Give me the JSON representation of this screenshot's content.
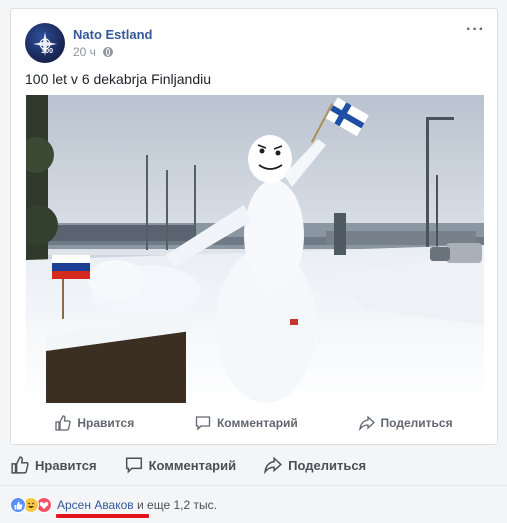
{
  "post": {
    "page_name": "Nato Estland",
    "time": "20 ч",
    "privacy_icon": "globe-icon",
    "more_icon": "more-horizontal-icon",
    "text": "100 let v 6 dekabrja Finljandiu",
    "avatar_tag": "100",
    "photo_icon": "snowman-photo"
  },
  "inner_actions": {
    "like": "Нравится",
    "comment": "Комментарий",
    "share": "Поделиться"
  },
  "outer_actions": {
    "like": "Нравится",
    "comment": "Комментарий",
    "share": "Поделиться"
  },
  "reactions": {
    "icons": [
      "like-reaction-icon",
      "haha-reaction-icon",
      "love-reaction-icon"
    ],
    "name": "Арсен Аваков",
    "rest": " и еще 1,2 тыс."
  },
  "colors": {
    "link": "#365899",
    "muted": "#90949c",
    "action_text": "#616770",
    "highlight": "#e2161a",
    "finland_blue": "#1f4fa5",
    "russia_red": "#d52b1e"
  }
}
